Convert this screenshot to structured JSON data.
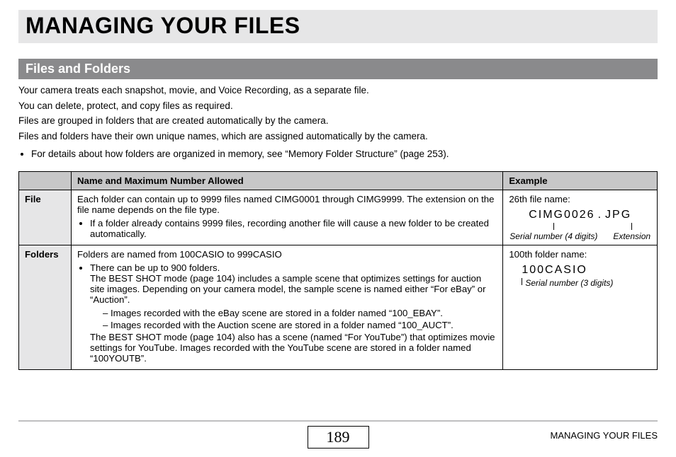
{
  "title": "MANAGING YOUR FILES",
  "section_heading": "Files and Folders",
  "intro": {
    "p1": "Your camera treats each snapshot, movie, and Voice Recording, as a separate file.",
    "p2": "You can delete, protect, and copy files as required.",
    "p3": "Files are grouped in folders that are created automatically by the camera.",
    "p4": "Files and folders have their own unique names, which are assigned automatically by the camera.",
    "bullet": "For details about how folders are organized in memory, see “Memory Folder Structure” (page 253)."
  },
  "table": {
    "head_left_blank": "",
    "head_name": "Name and Maximum Number Allowed",
    "head_example": "Example",
    "file_row_label": "File",
    "file_desc_main": "Each folder can contain up to 9999 files named CIMG0001 through CIMG9999. The extension on the file name depends on the file type.",
    "file_desc_bullet": "If a folder already contains 9999 files, recording another file will cause a new folder to be created automatically.",
    "file_example_label": "26th file name:",
    "file_example_serial": "CIMG0026",
    "file_example_dot": ".",
    "file_example_ext": "JPG",
    "file_example_ann_serial": "Serial number (4 digits)",
    "file_example_ann_ext": "Extension",
    "folder_row_label": "Folders",
    "folder_desc_main": "Folders are named from 100CASIO   to 999CASIO",
    "folder_desc_b1": "There can be up to 900 folders.",
    "folder_desc_b1_cont": "The BEST SHOT mode (page 104) includes a sample scene that optimizes settings for auction site images. Depending on your camera model, the sample scene is named either “For eBay” or “Auction”.",
    "folder_desc_sub1": "Images recorded with the eBay scene are stored in a folder named “100_EBAY”.",
    "folder_desc_sub2": "Images recorded with the Auction scene are stored in a folder named “100_AUCT”.",
    "folder_desc_after": "The BEST SHOT mode (page 104) also has a scene (named “For YouTube”) that optimizes movie settings for YouTube. Images recorded with the YouTube scene are stored in a folder named “100YOUTB”.",
    "folder_example_label": "100th folder name:",
    "folder_example_name": "100CASIO",
    "folder_example_ann": "Serial number (3 digits)"
  },
  "footer": {
    "page_number": "189",
    "title": "MANAGING YOUR FILES"
  }
}
